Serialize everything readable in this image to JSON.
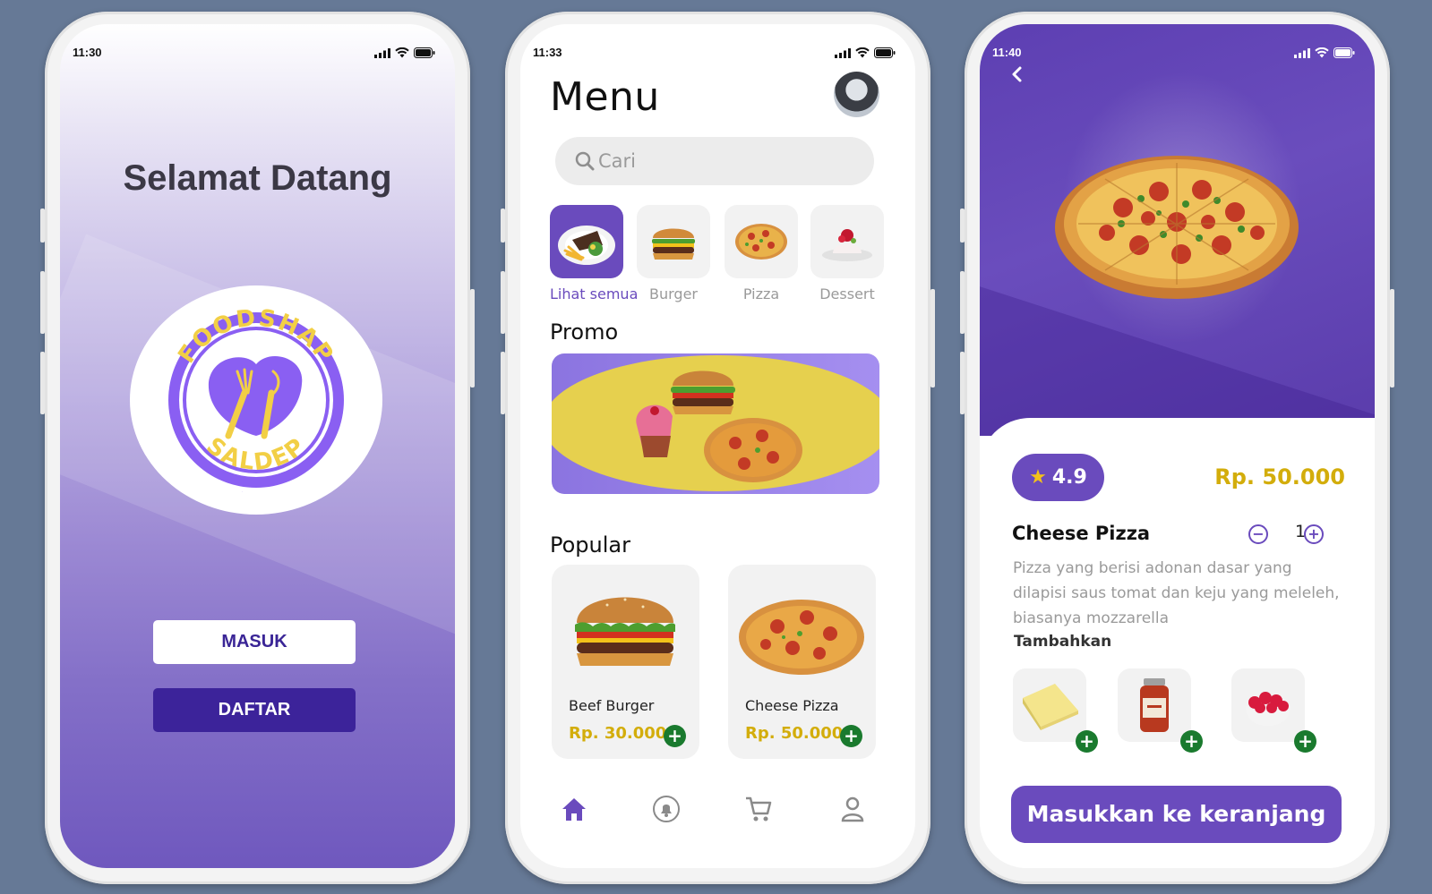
{
  "phone1": {
    "time": "11:30",
    "welcome": "Selamat Datang",
    "logo_text_top": "FOODSHAP",
    "logo_text_bottom": "SALDEP",
    "login_label": "MASUK",
    "register_label": "DAFTAR"
  },
  "phone2": {
    "time": "11:33",
    "title": "Menu",
    "search_placeholder": "Cari",
    "categories": [
      {
        "label": "Lihat semua",
        "active": true
      },
      {
        "label": "Burger",
        "active": false
      },
      {
        "label": "Pizza",
        "active": false
      },
      {
        "label": "Dessert",
        "active": false
      }
    ],
    "promo_title": "Promo",
    "popular_title": "Popular",
    "popular": [
      {
        "name": "Beef Burger",
        "price": "Rp. 30.000"
      },
      {
        "name": "Cheese Pizza",
        "price": "Rp. 50.000"
      }
    ],
    "nav": [
      "home-icon",
      "bell-icon",
      "cart-icon",
      "user-icon"
    ]
  },
  "phone3": {
    "time": "11:40",
    "rating": "4.9",
    "price": "Rp. 50.000",
    "name": "Cheese Pizza",
    "quantity": "1",
    "description": "Pizza yang berisi adonan dasar yang dilapisi saus tomat dan keju yang meleleh, biasanya mozzarella",
    "addons_title": "Tambahkan",
    "addons": [
      "cheese-icon",
      "tomato-sauce-jar-icon",
      "raspberry-bowl-icon"
    ],
    "cart_button": "Masukkan ke keranjang"
  },
  "colors": {
    "background": "#667996",
    "primary": "#6a4bbd",
    "dark_primary": "#3c239a",
    "price": "#d3ad0b",
    "add_button": "#1a7a2e"
  }
}
